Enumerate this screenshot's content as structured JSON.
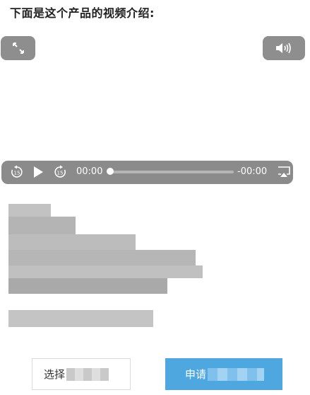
{
  "heading": "下面是这个产品的视频介绍:",
  "player": {
    "current_time": "00:00",
    "remaining_time": "-00:00",
    "progress": 0
  },
  "icons": {
    "fullscreen": "expand-arrows-icon",
    "volume": "speaker-icon",
    "skip_back": "rewind-15-icon",
    "play": "play-icon",
    "skip_forward": "forward-15-icon",
    "airplay": "airplay-icon"
  },
  "buttons": {
    "select_label": "选择",
    "apply_label": "申请"
  },
  "colors": {
    "control_bg": "#8b8b8b",
    "apply_bg": "#4fa7e0"
  }
}
